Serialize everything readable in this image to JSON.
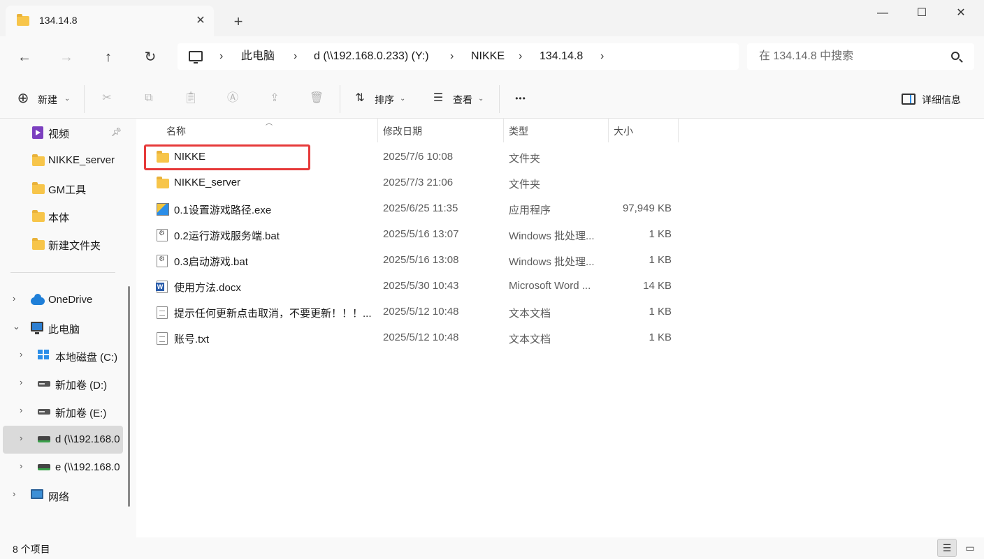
{
  "window": {
    "tab_title": "134.14.8",
    "new_tab_symbol": "+",
    "close_symbol": "✕",
    "minimize_symbol": "—",
    "maximize_symbol": "☐"
  },
  "nav": {
    "back_symbol": "←",
    "forward_symbol": "→",
    "up_symbol": "↑",
    "refresh_symbol": "↻",
    "breadcrumbs": [
      "此电脑",
      "d (\\\\192.168.0.233) (Y:)",
      "NIKKE",
      "134.14.8"
    ],
    "search_placeholder": "在 134.14.8 中搜索"
  },
  "toolbar": {
    "new_label": "新建",
    "sort_label": "排序",
    "view_label": "查看",
    "more_symbol": "•••",
    "details_label": "详细信息"
  },
  "sidebar": {
    "quick_access": [
      {
        "label": "视频",
        "icon": "video-icon",
        "pinned": true
      },
      {
        "label": "NIKKE_server",
        "icon": "folder-icon"
      },
      {
        "label": "GM工具",
        "icon": "folder-icon"
      },
      {
        "label": "本体",
        "icon": "folder-icon"
      },
      {
        "label": "新建文件夹",
        "icon": "folder-icon"
      }
    ],
    "tree": [
      {
        "label": "OneDrive",
        "icon": "onedrive-icon",
        "arrow": "›"
      },
      {
        "label": "此电脑",
        "icon": "this-pc-icon",
        "arrow": "⌄"
      },
      {
        "label": "本地磁盘 (C:)",
        "icon": "windows-drive-icon",
        "arrow": "›"
      },
      {
        "label": "新加卷 (D:)",
        "icon": "drive-icon",
        "arrow": "›"
      },
      {
        "label": "新加卷 (E:)",
        "icon": "drive-icon",
        "arrow": "›"
      },
      {
        "label": "d (\\\\192.168.0",
        "icon": "network-drive-icon",
        "arrow": "›",
        "selected": true
      },
      {
        "label": "e (\\\\192.168.0",
        "icon": "network-drive-icon",
        "arrow": "›"
      },
      {
        "label": "网络",
        "icon": "network-icon",
        "arrow": "›"
      }
    ]
  },
  "columns": {
    "name": "名称",
    "modified": "修改日期",
    "type": "类型",
    "size": "大小"
  },
  "files": [
    {
      "name": "NIKKE",
      "modified": "2025/7/6 10:08",
      "type": "文件夹",
      "size": "",
      "icon": "folder-icon",
      "highlighted": true
    },
    {
      "name": "NIKKE_server",
      "modified": "2025/7/3 21:06",
      "type": "文件夹",
      "size": "",
      "icon": "folder-icon"
    },
    {
      "name": "0.1设置游戏路径.exe",
      "modified": "2025/6/25 11:35",
      "type": "应用程序",
      "size": "97,949 KB",
      "icon": "exe-icon"
    },
    {
      "name": "0.2运行游戏服务端.bat",
      "modified": "2025/5/16 13:07",
      "type": "Windows 批处理...",
      "size": "1 KB",
      "icon": "bat-icon"
    },
    {
      "name": "0.3启动游戏.bat",
      "modified": "2025/5/16 13:08",
      "type": "Windows 批处理...",
      "size": "1 KB",
      "icon": "bat-icon"
    },
    {
      "name": "使用方法.docx",
      "modified": "2025/5/30 10:43",
      "type": "Microsoft Word ...",
      "size": "14 KB",
      "icon": "word-icon"
    },
    {
      "name": "提示任何更新点击取消，不要更新！！！...",
      "modified": "2025/5/12 10:48",
      "type": "文本文档",
      "size": "1 KB",
      "icon": "text-file-icon"
    },
    {
      "name": "账号.txt",
      "modified": "2025/5/12 10:48",
      "type": "文本文档",
      "size": "1 KB",
      "icon": "text-file-icon"
    }
  ],
  "status": {
    "item_count": "8 个项目"
  },
  "colors": {
    "highlight_border": "#e63a3a",
    "selected_sidebar": "#dadada"
  }
}
